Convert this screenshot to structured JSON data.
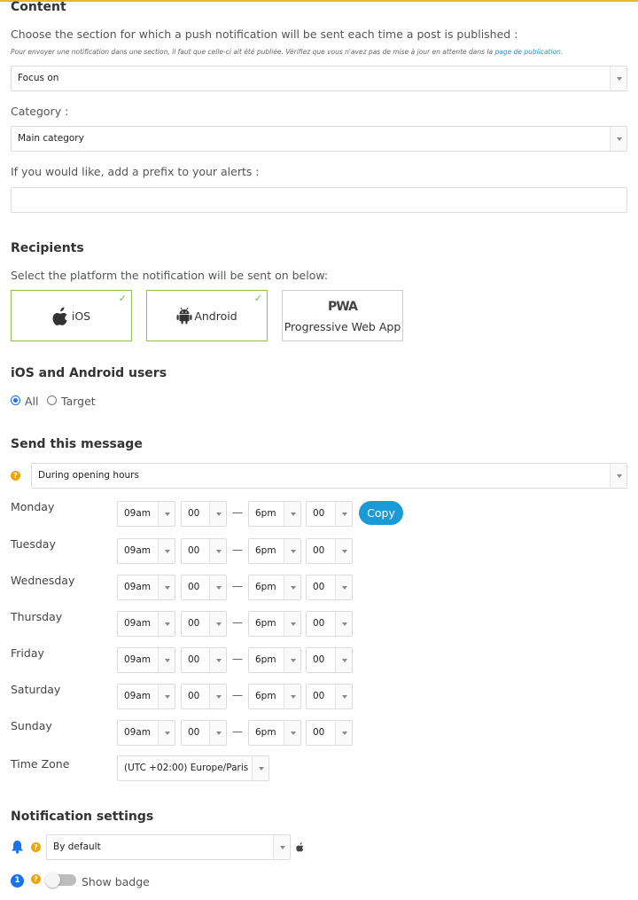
{
  "content": {
    "title": "Content",
    "section_prompt": "Choose the section for which a push notification will be sent each time a post is published :",
    "note_text": "Pour envoyer une notification dans une section, il faut que celle-ci ait été publiée. Vérifiez que vous n'avez pas de mise à jour en attente dans la ",
    "note_link": "page de publication",
    "note_end": ".",
    "section_value": "Focus on",
    "category_label": "Category :",
    "category_value": "Main category",
    "prefix_label": "If you would like, add a prefix to your alerts :",
    "prefix_value": ""
  },
  "recipients": {
    "title": "Recipients",
    "prompt": "Select the platform the notification will be sent on below:",
    "platforms": [
      {
        "label": "iOS",
        "selected": true
      },
      {
        "label": "Android",
        "selected": true
      },
      {
        "logo": "PWA",
        "label": "Progressive Web App",
        "selected": false
      }
    ],
    "check_glyph": "✓"
  },
  "users": {
    "title": "iOS and Android users",
    "options": [
      "All",
      "Target"
    ],
    "selected": "All"
  },
  "send": {
    "title": "Send this message",
    "mode_value": "During opening hours",
    "dash": "—",
    "copy_label": "Copy",
    "days": [
      {
        "name": "Monday",
        "start_h": "09am",
        "start_m": "00",
        "end_h": "6pm",
        "end_m": "00"
      },
      {
        "name": "Tuesday",
        "start_h": "09am",
        "start_m": "00",
        "end_h": "6pm",
        "end_m": "00"
      },
      {
        "name": "Wednesday",
        "start_h": "09am",
        "start_m": "00",
        "end_h": "6pm",
        "end_m": "00"
      },
      {
        "name": "Thursday",
        "start_h": "09am",
        "start_m": "00",
        "end_h": "6pm",
        "end_m": "00"
      },
      {
        "name": "Friday",
        "start_h": "09am",
        "start_m": "00",
        "end_h": "6pm",
        "end_m": "00"
      },
      {
        "name": "Saturday",
        "start_h": "09am",
        "start_m": "00",
        "end_h": "6pm",
        "end_m": "00"
      },
      {
        "name": "Sunday",
        "start_h": "09am",
        "start_m": "00",
        "end_h": "6pm",
        "end_m": "00"
      }
    ],
    "timezone_label": "Time Zone",
    "timezone_value": "(UTC +02:00) Europe/Paris"
  },
  "notification_settings": {
    "title": "Notification settings",
    "sound_value": "By default",
    "badge_count": "1",
    "badge_label": "Show badge",
    "help_glyph": "?"
  },
  "colors": {
    "accent": "#1a9bd7",
    "selected_border": "#8bc34a",
    "help": "#f0a500",
    "radio": "#1a73e8"
  }
}
